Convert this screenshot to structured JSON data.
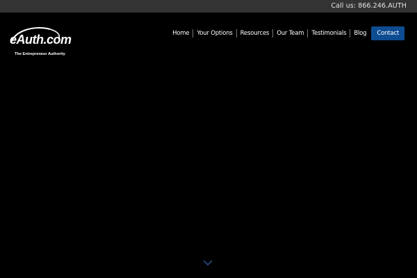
{
  "topbar": {
    "call_label": "Call us:",
    "phone": "866.246.AUTH"
  },
  "logo": {
    "brand": "eAuth.com",
    "tagline": "The Entrepreneur Authority"
  },
  "nav": {
    "items": [
      {
        "label": "Home"
      },
      {
        "label": "Your Options"
      },
      {
        "label": "Resources"
      },
      {
        "label": "Our Team"
      },
      {
        "label": "Testimonials"
      },
      {
        "label": "Blog"
      }
    ],
    "contact_label": "Contact"
  },
  "colors": {
    "topbar_bg": "#333333",
    "page_bg": "#000000",
    "accent": "#0e4c92",
    "chevron": "#1f3f6e"
  },
  "icons": {
    "scroll": "chevron-down-icon"
  }
}
